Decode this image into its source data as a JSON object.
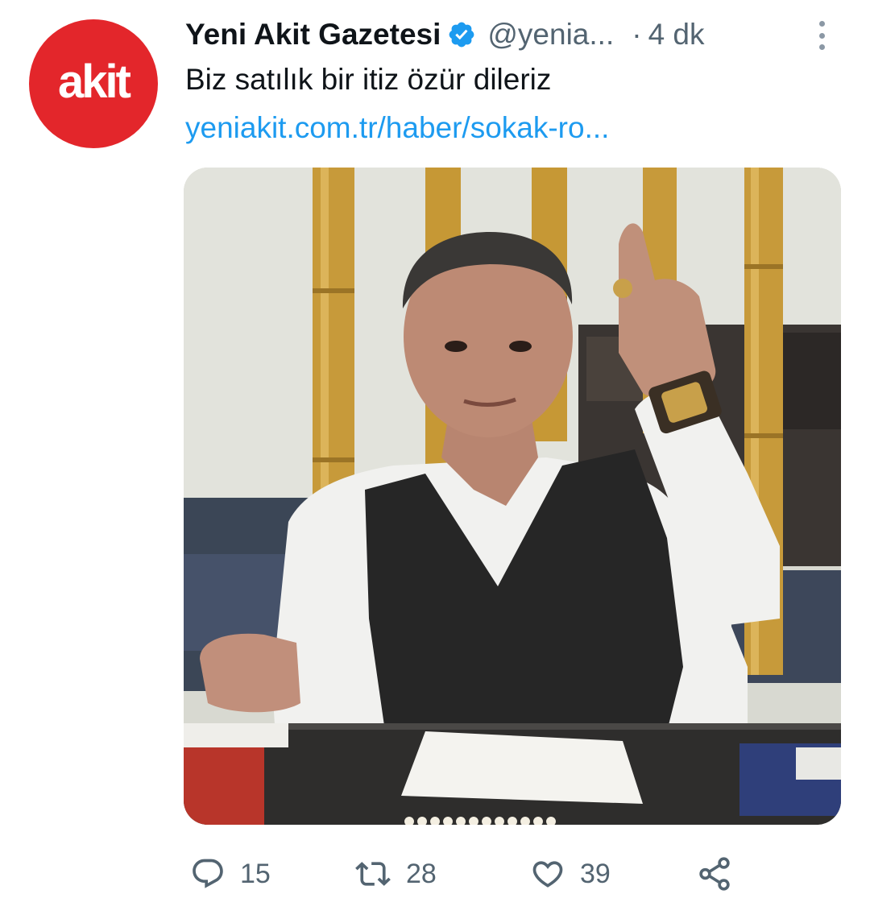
{
  "tweet": {
    "avatar": {
      "text": "akit",
      "bg_color": "#e3262b"
    },
    "author": {
      "display_name": "Yeni Akit Gazetesi",
      "verified_icon": "verified-badge-icon",
      "handle": "@yenia...",
      "separator": "·",
      "timestamp": "4 dk"
    },
    "text": "Biz satılık bir itiz özür dileriz",
    "link": "yeniakit.com.tr/haber/sokak-ro...",
    "actions": {
      "reply_count": "15",
      "retweet_count": "28",
      "like_count": "39"
    }
  },
  "colors": {
    "text_primary": "#0f1419",
    "text_secondary": "#536471",
    "link": "#1d9bf0",
    "verified": "#1d9bf0"
  },
  "icons": {
    "more": "more-vertical-icon",
    "reply": "reply-icon",
    "retweet": "retweet-icon",
    "like": "heart-icon",
    "share": "share-icon"
  }
}
